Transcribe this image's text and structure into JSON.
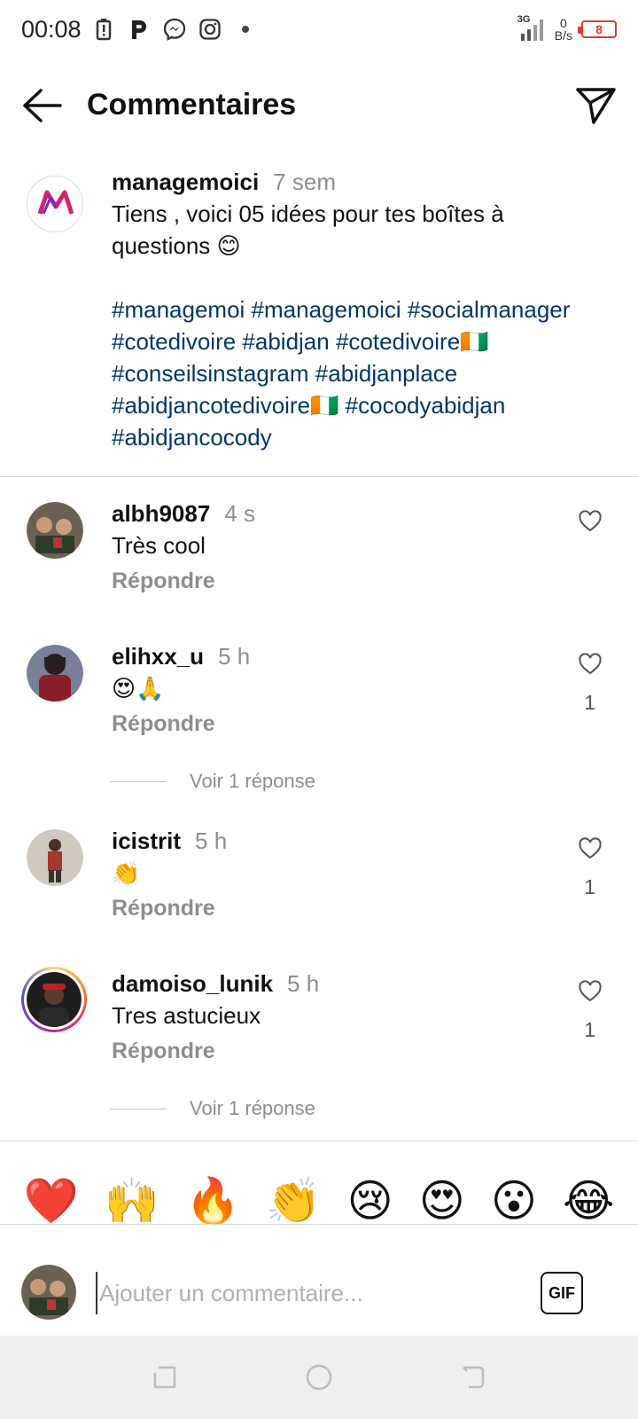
{
  "status_bar": {
    "time": "00:08",
    "net_speed_value": "0",
    "net_speed_unit": "B/s",
    "battery": "8",
    "network": "3G"
  },
  "header": {
    "title": "Commentaires"
  },
  "caption": {
    "username": "managemoici",
    "time": "7 sem",
    "text": "Tiens , voici 05 idées pour tes boîtes à questions 😊",
    "hashtags": "#managemoi #managemoici #socialmanager #cotedivoire #abidjan #cotedivoire🇨🇮 #conseilsinstagram #abidjanplace #abidjancotedivoire🇨🇮 #cocodyabidjan #abidjancocody",
    "avatar_label": "MANAGEMOI"
  },
  "comments": [
    {
      "username": "albh9087",
      "time": "4 s",
      "text": "Très cool",
      "reply": "Répondre",
      "likes": ""
    },
    {
      "username": "elihxx_u",
      "time": "5 h",
      "text": "😍🙏",
      "reply": "Répondre",
      "likes": "1",
      "view_replies": "Voir 1 réponse"
    },
    {
      "username": "icistrit",
      "time": "5 h",
      "text": "👏",
      "reply": "Répondre",
      "likes": "1"
    },
    {
      "username": "damoiso_lunik",
      "time": "5 h",
      "text": "Tres astucieux",
      "reply": "Répondre",
      "likes": "1",
      "view_replies": "Voir 1 réponse"
    }
  ],
  "emoji_bar": [
    "❤️",
    "🙌",
    "🔥",
    "👏",
    "😢",
    "😍",
    "😮",
    "😂"
  ],
  "input": {
    "placeholder": "Ajouter un commentaire...",
    "gif_label": "GIF"
  },
  "colors": {
    "hashtag": "#00376b",
    "muted": "#8e8e8e",
    "battery": "#e53935"
  }
}
